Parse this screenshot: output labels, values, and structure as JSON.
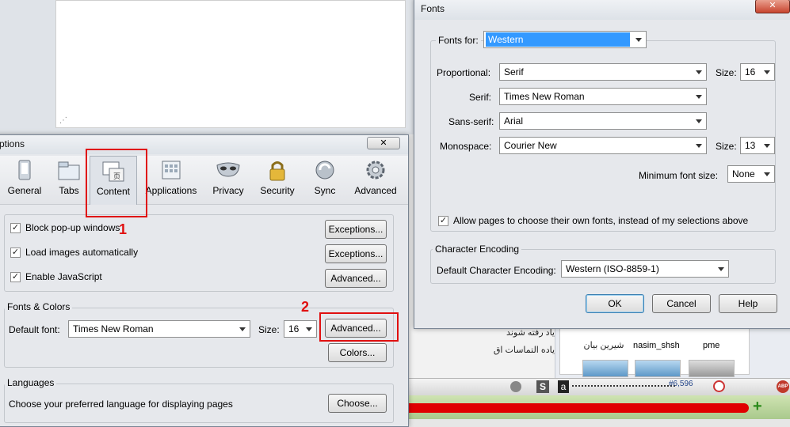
{
  "fonts_dialog": {
    "title": "Fonts",
    "fonts_for_label": "Fonts for:",
    "fonts_for_value": "Western",
    "proportional_label": "Proportional:",
    "proportional_value": "Serif",
    "size_label": "Size:",
    "proportional_size": "16",
    "serif_label": "Serif:",
    "serif_value": "Times New Roman",
    "sans_serif_label": "Sans-serif:",
    "sans_serif_value": "Arial",
    "monospace_label": "Monospace:",
    "monospace_value": "Courier New",
    "monospace_size": "13",
    "min_font_size_label": "Minimum font size:",
    "min_font_size_value": "None",
    "allow_pages_label": "Allow pages to choose their own fonts, instead of my selections above",
    "allow_pages_checked": "✓",
    "char_encoding_group": "Character Encoding",
    "default_encoding_label": "Default Character Encoding:",
    "default_encoding_value": "Western (ISO-8859-1)",
    "ok_label": "OK",
    "cancel_label": "Cancel",
    "help_label": "Help",
    "close_glyph": "✕"
  },
  "options_dialog": {
    "title": "ptions",
    "tabs": [
      {
        "label": "General",
        "icon": "general-icon"
      },
      {
        "label": "Tabs",
        "icon": "tabs-icon"
      },
      {
        "label": "Content",
        "icon": "content-icon"
      },
      {
        "label": "Applications",
        "icon": "applications-icon"
      },
      {
        "label": "Privacy",
        "icon": "privacy-mask-icon"
      },
      {
        "label": "Security",
        "icon": "padlock-icon"
      },
      {
        "label": "Sync",
        "icon": "sync-icon"
      },
      {
        "label": "Advanced",
        "icon": "gear-icon"
      }
    ],
    "block_popups_label": "Block pop-up windows",
    "load_images_label": "Load images automatically",
    "enable_js_label": "Enable JavaScript",
    "checked_glyph": "✓",
    "exceptions_label": "Exceptions...",
    "advanced_label": "Advanced...",
    "fonts_colors_group": "Fonts & Colors",
    "default_font_label": "Default font:",
    "default_font_value": "Times New Roman",
    "size_label": "Size:",
    "size_value": "16",
    "colors_label": "Colors...",
    "languages_group": "Languages",
    "languages_text": "Choose your preferred language for displaying pages",
    "choose_label": "Choose..."
  },
  "annotations": {
    "one": "1",
    "two": "2"
  },
  "background": {
    "rtl_line1": "یاد رفته شوند",
    "rtl_line2": "یاده التماسات اق",
    "user1": "شیرین بیان",
    "user2": "nasim_shsh",
    "user3": "pme",
    "status_count": "#6,596",
    "status_abp": "ABP"
  },
  "colors": {
    "selection": "#3399ff",
    "annotation": "#e01010",
    "dialog_bg": "#e6e8ec"
  }
}
